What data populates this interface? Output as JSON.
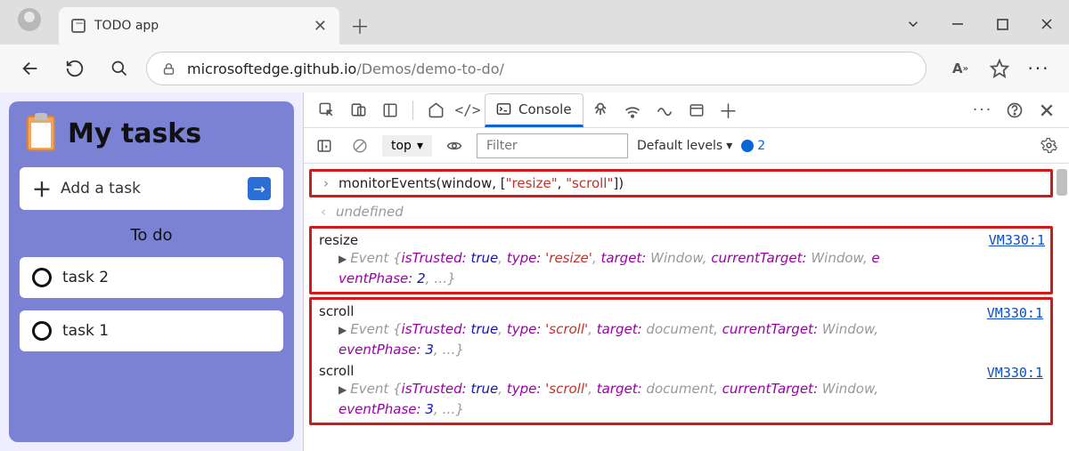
{
  "browser": {
    "tab_title": "TODO app",
    "url_prefix": "microsoftedge.github.io",
    "url_suffix": "/Demos/demo-to-do/"
  },
  "app": {
    "title": "My tasks",
    "add_placeholder": "Add a task",
    "section_label": "To do",
    "tasks": [
      "task 2",
      "task 1"
    ]
  },
  "devtools": {
    "console_tab_label": "Console",
    "context_label": "top",
    "filter_placeholder": "Filter",
    "levels_label": "Default levels",
    "issues_count": "2",
    "command": {
      "fn": "monitorEvents",
      "arg1": "window",
      "arg2a": "\"resize\"",
      "arg2b": "\"scroll\""
    },
    "undefined_label": "undefined",
    "source_link": "VM330:1",
    "events": [
      {
        "name": "resize",
        "detail_pre": "Event {",
        "k1": "isTrusted:",
        "v1": "true",
        "k2": "type:",
        "v2": "'resize'",
        "k3": "target:",
        "v3": "Window",
        "k4": "currentTarget:",
        "v4": "Window",
        "k5cont": "e",
        "line2_k": "ventPhase:",
        "line2_v": "2",
        "tail": ", …}"
      },
      {
        "name": "scroll",
        "detail_pre": "Event {",
        "k1": "isTrusted:",
        "v1": "true",
        "k2": "type:",
        "v2": "'scroll'",
        "k3": "target:",
        "v3": "document",
        "k4": "currentTarget:",
        "v4": "Window",
        "line2_k": "eventPhase:",
        "line2_v": "3",
        "tail": ", …}"
      },
      {
        "name": "scroll",
        "detail_pre": "Event {",
        "k1": "isTrusted:",
        "v1": "true",
        "k2": "type:",
        "v2": "'scroll'",
        "k3": "target:",
        "v3": "document",
        "k4": "currentTarget:",
        "v4": "Window",
        "line2_k": "eventPhase:",
        "line2_v": "3",
        "tail": ", …}"
      }
    ]
  }
}
